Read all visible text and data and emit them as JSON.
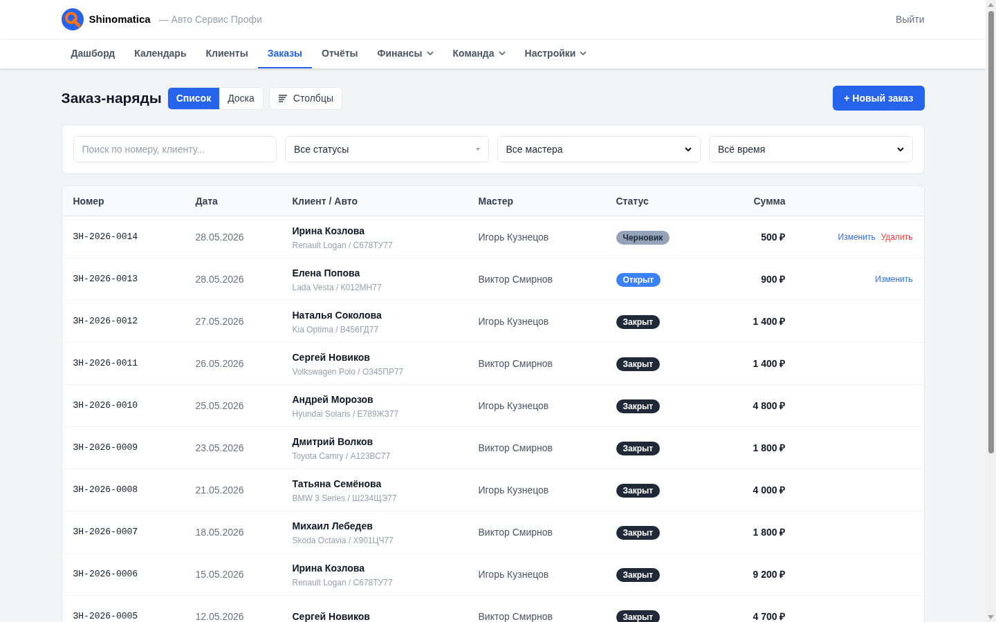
{
  "brand": {
    "name": "Shinomatica",
    "tagline": "— Авто Сервис Профи"
  },
  "logout": "Выйти",
  "nav": [
    {
      "label": "Дашборд",
      "selected": false,
      "dropdown": false
    },
    {
      "label": "Календарь",
      "selected": false,
      "dropdown": false
    },
    {
      "label": "Клиенты",
      "selected": false,
      "dropdown": false
    },
    {
      "label": "Заказы",
      "selected": true,
      "dropdown": false
    },
    {
      "label": "Отчёты",
      "selected": false,
      "dropdown": false
    },
    {
      "label": "Финансы",
      "selected": false,
      "dropdown": true
    },
    {
      "label": "Команда",
      "selected": false,
      "dropdown": true
    },
    {
      "label": "Настройки",
      "selected": false,
      "dropdown": true
    }
  ],
  "page_title": "Заказ-наряды",
  "view_toggle": [
    {
      "label": "Список",
      "selected": true
    },
    {
      "label": "Доска",
      "selected": false
    }
  ],
  "columns_button": "Столбцы",
  "new_button": "+ Новый заказ",
  "filters": [
    {
      "kind": "search",
      "placeholder": "Поиск по номеру, клиенту..."
    },
    {
      "kind": "custom_select",
      "value": "Все статусы"
    },
    {
      "kind": "native_select",
      "value": "Все мастера"
    },
    {
      "kind": "native_select",
      "value": "Всё время"
    }
  ],
  "table": {
    "columns": [
      "Номер",
      "Дата",
      "Клиент / Авто",
      "Мастер",
      "Статус",
      "Сумма"
    ],
    "rows": [
      {
        "number": "ЗН-2026-0014",
        "date": "28.05.2026",
        "client": "Ирина Козлова",
        "car": "Renault Logan / С678ТУ77",
        "master": "Игорь Кузнецов",
        "status": {
          "label": "Черновик",
          "kind": "draft"
        },
        "sum": "500 ₽",
        "actions": [
          {
            "label": "Изменить",
            "kind": "edit"
          },
          {
            "label": "Удалить",
            "kind": "delete"
          }
        ]
      },
      {
        "number": "ЗН-2026-0013",
        "date": "28.05.2026",
        "client": "Елена Попова",
        "car": "Lada Vesta / К012МН77",
        "master": "Виктор Смирнов",
        "status": {
          "label": "Открыт",
          "kind": "open"
        },
        "sum": "900 ₽",
        "actions": [
          {
            "label": "Изменить",
            "kind": "edit"
          }
        ]
      },
      {
        "number": "ЗН-2026-0012",
        "date": "27.05.2026",
        "client": "Наталья Соколова",
        "car": "Kia Optima / В456ГД77",
        "master": "Игорь Кузнецов",
        "status": {
          "label": "Закрыт",
          "kind": "closed"
        },
        "sum": "1 400 ₽"
      },
      {
        "number": "ЗН-2026-0011",
        "date": "26.05.2026",
        "client": "Сергей Новиков",
        "car": "Volkswagen Polo / О345ПР77",
        "master": "Виктор Смирнов",
        "status": {
          "label": "Закрыт",
          "kind": "closed"
        },
        "sum": "1 400 ₽"
      },
      {
        "number": "ЗН-2026-0010",
        "date": "25.05.2026",
        "client": "Андрей Морозов",
        "car": "Hyundai Solaris / Е789ЖЗ77",
        "master": "Игорь Кузнецов",
        "status": {
          "label": "Закрыт",
          "kind": "closed"
        },
        "sum": "4 800 ₽"
      },
      {
        "number": "ЗН-2026-0009",
        "date": "23.05.2026",
        "client": "Дмитрий Волков",
        "car": "Toyota Camry / А123ВС77",
        "master": "Виктор Смирнов",
        "status": {
          "label": "Закрыт",
          "kind": "closed"
        },
        "sum": "1 800 ₽"
      },
      {
        "number": "ЗН-2026-0008",
        "date": "21.05.2026",
        "client": "Татьяна Семёнова",
        "car": "BMW 3 Series / Ш234ЩЭ77",
        "master": "Игорь Кузнецов",
        "status": {
          "label": "Закрыт",
          "kind": "closed"
        },
        "sum": "4 000 ₽"
      },
      {
        "number": "ЗН-2026-0007",
        "date": "18.05.2026",
        "client": "Михаил Лебедев",
        "car": "Skoda Octavia / Х901ЦЧ77",
        "master": "Виктор Смирнов",
        "status": {
          "label": "Закрыт",
          "kind": "closed"
        },
        "sum": "1 800 ₽"
      },
      {
        "number": "ЗН-2026-0006",
        "date": "15.05.2026",
        "client": "Ирина Козлова",
        "car": "Renault Logan / С678ТУ77",
        "master": "Игорь Кузнецов",
        "status": {
          "label": "Закрыт",
          "kind": "closed"
        },
        "sum": "9 200 ₽"
      },
      {
        "number": "ЗН-2026-0005",
        "date": "12.05.2026",
        "client": "Сергей Новиков",
        "master": "Виктор Смирнов",
        "status": {
          "label": "Закрыт",
          "kind": "closed"
        },
        "sum": "4 700 ₽"
      }
    ]
  }
}
